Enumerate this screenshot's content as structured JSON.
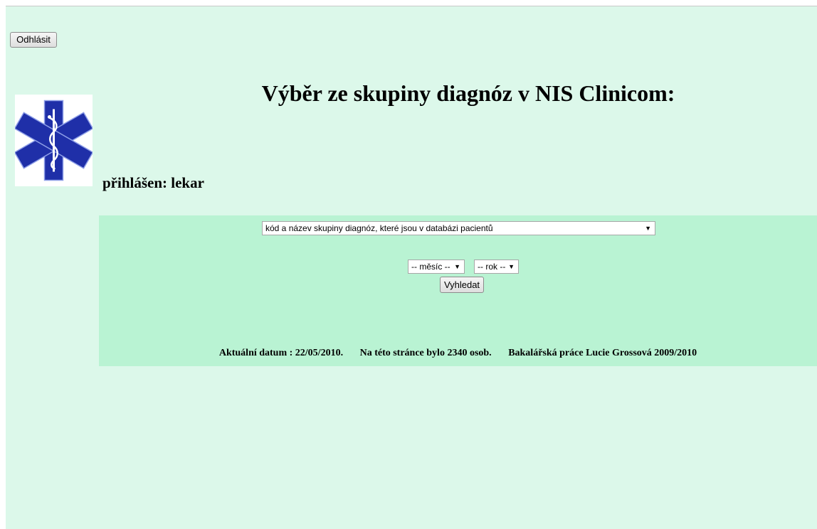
{
  "header": {
    "logout_label": "Odhlásit",
    "title": "Výběr ze skupiny diagnóz v NIS Clinicom:",
    "logged_in_text": "přihlášen: lekar"
  },
  "form": {
    "diagnosis_select_value": "kód a název skupiny diagnóz, které jsou v databázi pacientů",
    "month_select_value": "-- měsíc --",
    "year_select_value": "-- rok --",
    "search_label": "Vyhledat"
  },
  "footer": {
    "date_text": "Aktuální datum : 22/05/2010.",
    "visitors_text": "Na této stránce bylo 2340 osob.",
    "thesis_text": "Bakalářská práce Lucie Grossová 2009/2010"
  },
  "colors": {
    "page_background": "#dcf8ea",
    "panel_background": "#b9f3d3",
    "logo_blue": "#1f2fa8"
  },
  "icons": {
    "logo": "star-of-life-icon"
  }
}
